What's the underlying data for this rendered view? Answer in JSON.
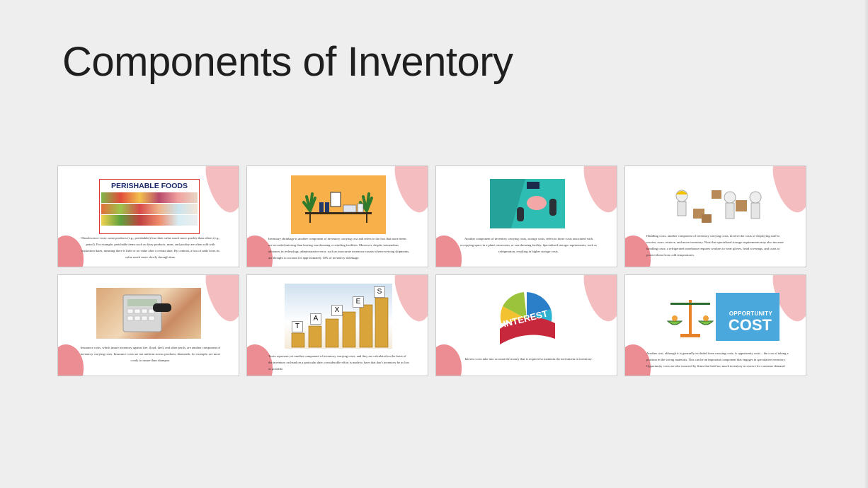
{
  "slide": {
    "title": "Components of Inventory"
  },
  "thumbnails": [
    {
      "id": "perishable",
      "image_label": "PERISHABLE FOODS",
      "caption": "Obsolescence costs: some products (e.g., perishables) lose their value much more quickly than others (e.g., petrol). For example, perishable items such as dairy products, meat, and poultry are often sold with expiration dates, meaning there is little or no value after a certain date. By contrast, a box of nails loses its value much more slowly through time."
    },
    {
      "id": "shrinkage",
      "caption": "Inventory shrinkage is another component of inventory carrying cost and refers to the fact that more items are recorded entering than leaving warehousing or retailing facilities. Moreover, despite tremendous advances in technology, administrative error, such as inaccurate inventory counts when receiving shipments, are thought to account for approximately 10% of inventory shrinkage."
    },
    {
      "id": "storage",
      "caption": "Another component of inventory carrying costs, storage costs, refers to those costs associated with occupying space in a plant, storeroom, or warehousing facility. Specialized storage requirements, such as refrigeration, resulting in higher storage costs."
    },
    {
      "id": "handling",
      "caption": "Handling costs, another component of inventory carrying costs, involve the costs of employing staff to receive, store, retrieve, and move inventory. Note that specialized storage requirements may also increase handling costs; a refrigerated warehouse requires workers to wear gloves, head coverings, and coats to protect them from cold temperatures."
    },
    {
      "id": "insurance",
      "caption": "Insurance costs, which insure inventory against fire, flood, theft, and other perils, are another component of inventory carrying costs. Insurance costs are not uniform across products; diamonds, for example, are more costly to insure than shampoo."
    },
    {
      "id": "taxes",
      "image_letters": [
        "T",
        "A",
        "X",
        "E",
        "S"
      ],
      "caption": "Taxes represent yet another component of inventory carrying costs, and they are calculated on the basis of the inventory on hand on a particular date; considerable effort is made to have that day's inventory be as low as possible."
    },
    {
      "id": "interest",
      "image_label": "INTEREST",
      "caption": "Interest costs take into account the money that is required to maintain the investment in inventory."
    },
    {
      "id": "opportunity",
      "image_label_1": "OPPORTUNITY",
      "image_label_2": "COST",
      "caption": "Another cost, although it is generally excluded from carrying costs, is opportunity costs – the cost of taking a position in the wrong materials. This can be an important component that engages in speculative inventory. Opportunity costs are also incurred by firms that hold too much inventory in reserve for customer demand."
    }
  ],
  "colors": {
    "background": "#eeeeee",
    "blob_light": "#f3b7b9",
    "blob_dark": "#ec8d93",
    "opportunity_blue": "#4aa8dd",
    "shelf_orange": "#f8b04b",
    "teal": "#2dbdb3"
  }
}
